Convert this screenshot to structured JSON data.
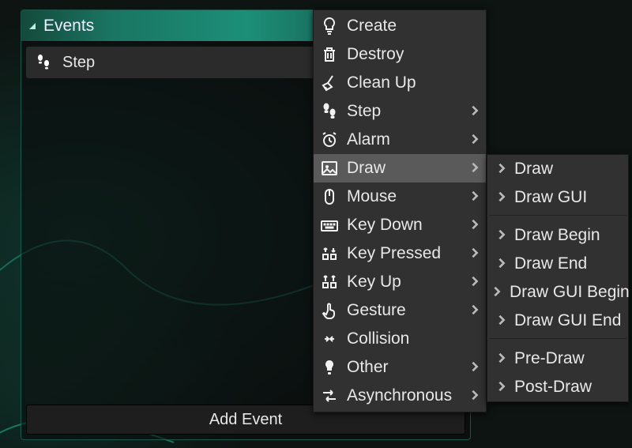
{
  "panel": {
    "title": "Events",
    "items": [
      {
        "label": "Step",
        "icon": "footprints-icon"
      }
    ],
    "add_button": "Add Event"
  },
  "menu": {
    "items": [
      {
        "label": "Create",
        "icon": "lightbulb-icon",
        "submenu": false
      },
      {
        "label": "Destroy",
        "icon": "trash-icon",
        "submenu": false
      },
      {
        "label": "Clean Up",
        "icon": "broom-icon",
        "submenu": false
      },
      {
        "label": "Step",
        "icon": "footprints-icon",
        "submenu": true
      },
      {
        "label": "Alarm",
        "icon": "alarm-icon",
        "submenu": true
      },
      {
        "label": "Draw",
        "icon": "image-icon",
        "submenu": true,
        "highlight": true
      },
      {
        "label": "Mouse",
        "icon": "mouse-icon",
        "submenu": true
      },
      {
        "label": "Key Down",
        "icon": "keyboard-icon",
        "submenu": true
      },
      {
        "label": "Key Pressed",
        "icon": "keypress-icon",
        "submenu": true
      },
      {
        "label": "Key Up",
        "icon": "keyup-icon",
        "submenu": true
      },
      {
        "label": "Gesture",
        "icon": "gesture-icon",
        "submenu": true
      },
      {
        "label": "Collision",
        "icon": "collision-icon",
        "submenu": false
      },
      {
        "label": "Other",
        "icon": "other-icon",
        "submenu": true
      },
      {
        "label": "Asynchronous",
        "icon": "async-icon",
        "submenu": true
      }
    ]
  },
  "submenu": {
    "groups": [
      [
        {
          "label": "Draw"
        },
        {
          "label": "Draw GUI"
        }
      ],
      [
        {
          "label": "Draw Begin"
        },
        {
          "label": "Draw End"
        },
        {
          "label": "Draw GUI Begin"
        },
        {
          "label": "Draw GUI End"
        }
      ],
      [
        {
          "label": "Pre-Draw"
        },
        {
          "label": "Post-Draw"
        }
      ]
    ]
  }
}
